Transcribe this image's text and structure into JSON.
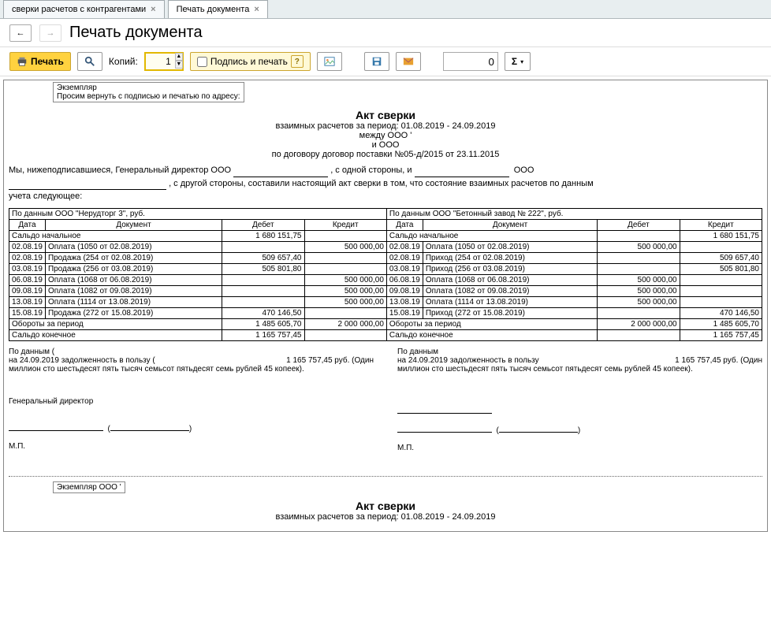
{
  "tabs": [
    {
      "label": "сверки расчетов с контрагентами",
      "active": false
    },
    {
      "label": "Печать документа",
      "active": true
    }
  ],
  "page_title": "Печать документа",
  "toolbar": {
    "print": "Печать",
    "copies_label": "Копий:",
    "copies_value": "1",
    "sign_print": "Подпись и печать",
    "num_value": "0"
  },
  "doc": {
    "exemplar_note": "Экземпляр",
    "return_note": "Просим вернуть с подписью и печатью по адресу:",
    "title": "Акт сверки",
    "sub1": "взаимных расчетов за период: 01.08.2019 - 24.09.2019",
    "sub2": "между ООО '",
    "sub3": "и ООО",
    "sub4": "по договору договор поставки №05-д/2015 от 23.11.2015",
    "intro_a": "Мы, нижеподписавшиеся, Генеральный директор ООО",
    "intro_b": ", с одной стороны, и ",
    "intro_c": "ООО",
    "intro_d": ", с другой стороны, составили настоящий акт сверки в том, что состояние взаимных расчетов по данным",
    "intro_e": "учета следующее:",
    "left_header": "По данным ООО \"Нерудторг 3\", руб.",
    "right_header": "По данным ООО \"Бетонный завод № 222\", руб.",
    "col_date": "Дата",
    "col_doc": "Документ",
    "col_debit": "Дебет",
    "col_credit": "Кредит",
    "saldo_start": "Сальдо начальное",
    "saldo_start_val": "1 680 151,75",
    "rows_left": [
      {
        "date": "02.08.19",
        "doc": "Оплата (1050 от 02.08.2019)",
        "debit": "",
        "credit": "500 000,00"
      },
      {
        "date": "02.08.19",
        "doc": "Продажа (254 от 02.08.2019)",
        "debit": "509 657,40",
        "credit": ""
      },
      {
        "date": "03.08.19",
        "doc": "Продажа (256 от 03.08.2019)",
        "debit": "505 801,80",
        "credit": ""
      },
      {
        "date": "06.08.19",
        "doc": "Оплата (1068 от 06.08.2019)",
        "debit": "",
        "credit": "500 000,00"
      },
      {
        "date": "09.08.19",
        "doc": "Оплата (1082 от 09.08.2019)",
        "debit": "",
        "credit": "500 000,00"
      },
      {
        "date": "13.08.19",
        "doc": "Оплата (1114 от 13.08.2019)",
        "debit": "",
        "credit": "500 000,00"
      },
      {
        "date": "15.08.19",
        "doc": "Продажа (272 от 15.08.2019)",
        "debit": "470 146,50",
        "credit": ""
      }
    ],
    "rows_right": [
      {
        "date": "02.08.19",
        "doc": "Оплата (1050 от 02.08.2019)",
        "debit": "500 000,00",
        "credit": ""
      },
      {
        "date": "02.08.19",
        "doc": "Приход (254 от 02.08.2019)",
        "debit": "",
        "credit": "509 657,40"
      },
      {
        "date": "03.08.19",
        "doc": "Приход (256 от 03.08.2019)",
        "debit": "",
        "credit": "505 801,80"
      },
      {
        "date": "06.08.19",
        "doc": "Оплата (1068 от 06.08.2019)",
        "debit": "500 000,00",
        "credit": ""
      },
      {
        "date": "09.08.19",
        "doc": "Оплата (1082 от 09.08.2019)",
        "debit": "500 000,00",
        "credit": ""
      },
      {
        "date": "13.08.19",
        "doc": "Оплата (1114 от 13.08.2019)",
        "debit": "500 000,00",
        "credit": ""
      },
      {
        "date": "15.08.19",
        "doc": "Приход (272 от 15.08.2019)",
        "debit": "",
        "credit": "470 146,50"
      }
    ],
    "turnover_label": "Обороты за период",
    "turnover_left_d": "1 485 605,70",
    "turnover_left_c": "2 000 000,00",
    "turnover_right_d": "2 000 000,00",
    "turnover_right_c": "1 485 605,70",
    "saldo_end": "Сальдо конечное",
    "saldo_end_left": "1 165 757,45",
    "saldo_end_right": "1 165 757,45",
    "summary_l1": "По данным (",
    "summary_l2": "на 24.09.2019 задолженность в пользу (",
    "summary_l3": "1 165 757,45 руб. (Один",
    "summary_l4": "миллион сто шестьдесят пять тысяч семьсот пятьдесят семь рублей 45 копеек).",
    "summary_r1": "По данным",
    "summary_r2": "на 24.09.2019 задолженность в пользу",
    "sig_role": "Генеральный директор",
    "mp": "М.П.",
    "exemplar2": "Экземпляр ООО '"
  }
}
